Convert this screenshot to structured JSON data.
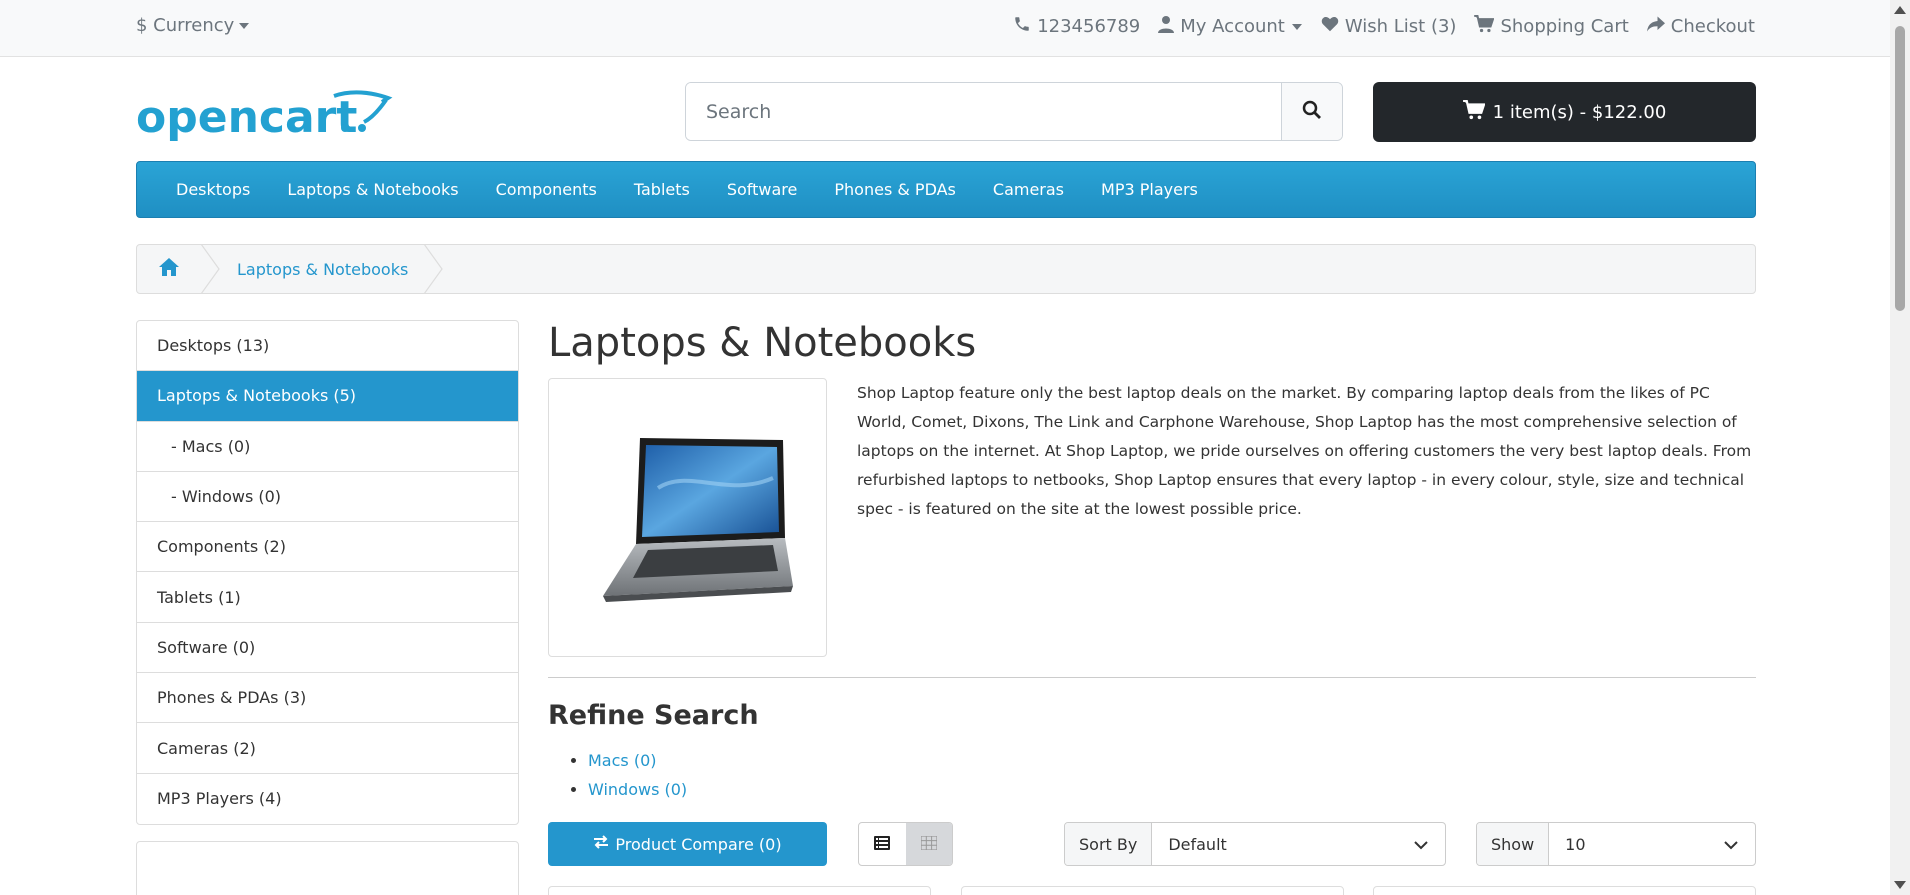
{
  "topbar": {
    "currency": "$ Currency",
    "phone": "123456789",
    "my_account": "My Account",
    "wishlist": "Wish List (3)",
    "cart": "Shopping Cart",
    "checkout": "Checkout"
  },
  "header": {
    "logo_text": "opencart",
    "search_placeholder": "Search",
    "cart_button": "1 item(s) - $122.00"
  },
  "menu": [
    "Desktops",
    "Laptops & Notebooks",
    "Components",
    "Tablets",
    "Software",
    "Phones & PDAs",
    "Cameras",
    "MP3 Players"
  ],
  "breadcrumb": {
    "current": "Laptops & Notebooks"
  },
  "sidebar": [
    {
      "label": "Desktops (13)",
      "active": false,
      "sub": false
    },
    {
      "label": "Laptops & Notebooks (5)",
      "active": true,
      "sub": false
    },
    {
      "label": "- Macs (0)",
      "active": false,
      "sub": true
    },
    {
      "label": "- Windows (0)",
      "active": false,
      "sub": true
    },
    {
      "label": "Components (2)",
      "active": false,
      "sub": false
    },
    {
      "label": "Tablets (1)",
      "active": false,
      "sub": false
    },
    {
      "label": "Software (0)",
      "active": false,
      "sub": false
    },
    {
      "label": "Phones & PDAs (3)",
      "active": false,
      "sub": false
    },
    {
      "label": "Cameras (2)",
      "active": false,
      "sub": false
    },
    {
      "label": "MP3 Players (4)",
      "active": false,
      "sub": false
    }
  ],
  "main": {
    "title": "Laptops & Notebooks",
    "description": "Shop Laptop feature only the best laptop deals on the market. By comparing laptop deals from the likes of PC World, Comet, Dixons, The Link and Carphone Warehouse, Shop Laptop has the most comprehensive selection of laptops on the internet. At Shop Laptop, we pride ourselves on offering customers the very best laptop deals. From refurbished laptops to netbooks, Shop Laptop ensures that every laptop - in every colour, style, size and technical spec - is featured on the site at the lowest possible price.",
    "refine_title": "Refine Search",
    "refine_links": [
      "Macs (0)",
      "Windows (0)"
    ],
    "compare_button": "Product Compare (0)",
    "sort_label": "Sort By",
    "sort_value": "Default",
    "show_label": "Show",
    "show_value": "10"
  },
  "colors": {
    "accent": "#2496cd",
    "dark": "#23272b"
  }
}
